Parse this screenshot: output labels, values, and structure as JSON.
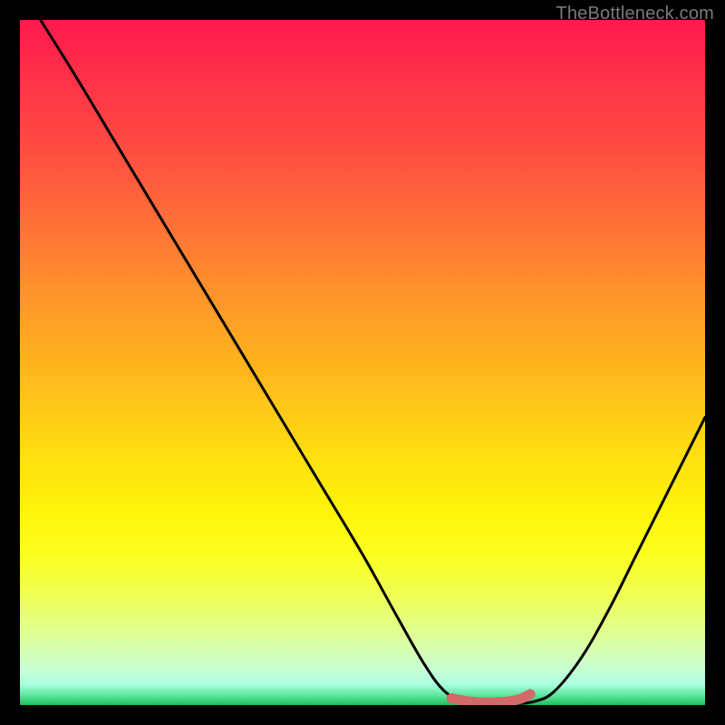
{
  "watermark": "TheBottleneck.com",
  "chart_data": {
    "type": "line",
    "title": "",
    "xlabel": "",
    "ylabel": "",
    "xlim": [
      0,
      100
    ],
    "ylim": [
      0,
      100
    ],
    "series": [
      {
        "name": "bottleneck-curve",
        "x": [
          3,
          8,
          14,
          20,
          26,
          32,
          38,
          44,
          50,
          55,
          59,
          62,
          65,
          68,
          72,
          75,
          78,
          82,
          86,
          90,
          94,
          98,
          100
        ],
        "y": [
          100,
          92,
          82,
          72,
          62,
          52,
          42,
          32,
          22,
          13,
          6,
          2,
          0.5,
          0.2,
          0.2,
          0.5,
          2,
          7,
          14,
          22,
          30,
          38,
          42
        ]
      }
    ],
    "highlight": {
      "name": "optimal-zone",
      "x": [
        63,
        65,
        67,
        69,
        71,
        73,
        74.5
      ],
      "y": [
        1.0,
        0.6,
        0.4,
        0.4,
        0.5,
        0.9,
        1.6
      ]
    }
  },
  "colors": {
    "curve": "#000000",
    "highlight": "#d26a6a",
    "background_top": "#ff1a4d",
    "background_bottom": "#1fbf5e"
  }
}
